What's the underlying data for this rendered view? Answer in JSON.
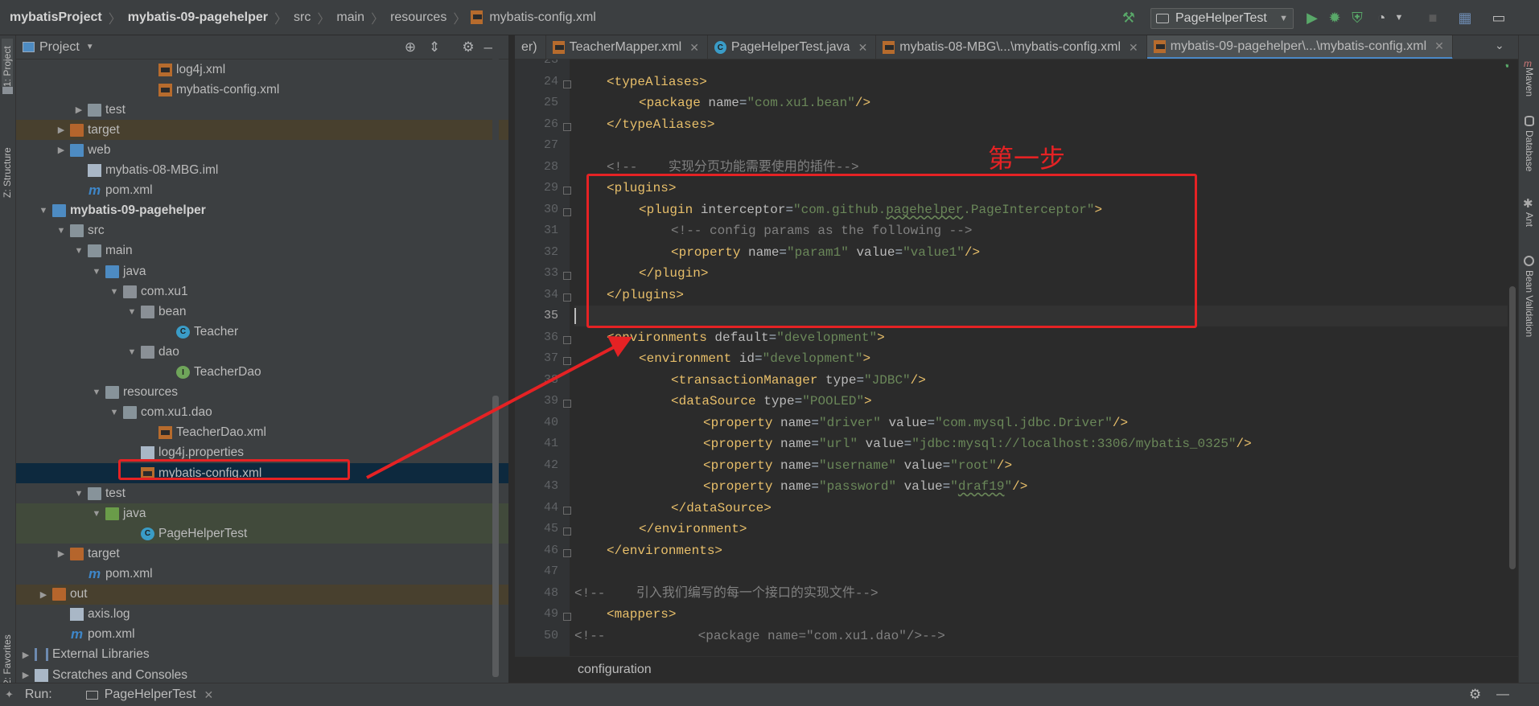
{
  "breadcrumb": [
    "mybatisProject",
    "mybatis-09-pagehelper",
    "src",
    "main",
    "resources",
    "mybatis-config.xml"
  ],
  "toolbar": {
    "run_config": "PageHelperTest",
    "icons": [
      "hammer-icon",
      "run-config-dropdown",
      "run-icon",
      "debug-icon",
      "coverage-icon",
      "profiler-icon",
      "stop-icon",
      "project-structure-icon",
      "toggle-layout-icon"
    ]
  },
  "left_strip": {
    "project": "1: Project",
    "structure": "Z: Structure",
    "favorites": "2: Favorites"
  },
  "right_strip": {
    "maven": "Maven",
    "database": "Database",
    "ant": "Ant",
    "bean_validation": "Bean Validation"
  },
  "project_panel": {
    "title": "Project",
    "rows": [
      {
        "label": "log4j.xml",
        "indent": 7,
        "icon": "xml",
        "arrow": ""
      },
      {
        "label": "mybatis-config.xml",
        "indent": 7,
        "icon": "xml",
        "arrow": ""
      },
      {
        "label": "test",
        "indent": 3,
        "icon": "folder",
        "arrow": "right"
      },
      {
        "label": "target",
        "indent": 2,
        "icon": "folder-target",
        "arrow": "right",
        "style": "tgt"
      },
      {
        "label": "web",
        "indent": 2,
        "icon": "folder-web",
        "arrow": "right"
      },
      {
        "label": "mybatis-08-MBG.iml",
        "indent": 3,
        "icon": "iml",
        "arrow": ""
      },
      {
        "label": "pom.xml",
        "indent": 3,
        "icon": "maven",
        "arrow": ""
      },
      {
        "label": "mybatis-09-pagehelper",
        "indent": 1,
        "icon": "module",
        "arrow": "down",
        "style": "bold"
      },
      {
        "label": "src",
        "indent": 2,
        "icon": "folder",
        "arrow": "down"
      },
      {
        "label": "main",
        "indent": 3,
        "icon": "folder",
        "arrow": "down"
      },
      {
        "label": "java",
        "indent": 4,
        "icon": "folder-blue",
        "arrow": "down"
      },
      {
        "label": "com.xu1",
        "indent": 5,
        "icon": "package",
        "arrow": "down"
      },
      {
        "label": "bean",
        "indent": 6,
        "icon": "package",
        "arrow": "down"
      },
      {
        "label": "Teacher",
        "indent": 8,
        "icon": "class",
        "arrow": ""
      },
      {
        "label": "dao",
        "indent": 6,
        "icon": "package",
        "arrow": "down"
      },
      {
        "label": "TeacherDao",
        "indent": 8,
        "icon": "interface",
        "arrow": ""
      },
      {
        "label": "resources",
        "indent": 4,
        "icon": "folder-res",
        "arrow": "down"
      },
      {
        "label": "com.xu1.dao",
        "indent": 5,
        "icon": "folder",
        "arrow": "down"
      },
      {
        "label": "TeacherDao.xml",
        "indent": 7,
        "icon": "xml",
        "arrow": ""
      },
      {
        "label": "log4j.properties",
        "indent": 6,
        "icon": "props",
        "arrow": ""
      },
      {
        "label": "mybatis-config.xml",
        "indent": 6,
        "icon": "xml",
        "arrow": "",
        "style": "sel"
      },
      {
        "label": "test",
        "indent": 3,
        "icon": "folder",
        "arrow": "down"
      },
      {
        "label": "java",
        "indent": 4,
        "icon": "folder-green",
        "arrow": "down",
        "style": "tst"
      },
      {
        "label": "PageHelperTest",
        "indent": 6,
        "icon": "class",
        "arrow": "",
        "style": "tst"
      },
      {
        "label": "target",
        "indent": 2,
        "icon": "folder-target",
        "arrow": "right"
      },
      {
        "label": "pom.xml",
        "indent": 3,
        "icon": "maven",
        "arrow": ""
      },
      {
        "label": "out",
        "indent": 1,
        "icon": "folder-target",
        "arrow": "right",
        "style": "tgt"
      },
      {
        "label": "axis.log",
        "indent": 2,
        "icon": "file",
        "arrow": ""
      },
      {
        "label": "pom.xml",
        "indent": 2,
        "icon": "maven",
        "arrow": ""
      },
      {
        "label": "External Libraries",
        "indent": 0,
        "icon": "library",
        "arrow": "right"
      },
      {
        "label": "Scratches and Consoles",
        "indent": 0,
        "icon": "scratch",
        "arrow": "right"
      }
    ]
  },
  "tabs": [
    {
      "label": "er)",
      "icon": "",
      "closable": false,
      "active": false
    },
    {
      "label": "TeacherMapper.xml",
      "icon": "xml",
      "closable": true,
      "active": false
    },
    {
      "label": "PageHelperTest.java",
      "icon": "class",
      "closable": true,
      "active": false
    },
    {
      "label": "mybatis-08-MBG\\...\\mybatis-config.xml",
      "icon": "xml",
      "closable": true,
      "active": false
    },
    {
      "label": "mybatis-09-pagehelper\\...\\mybatis-config.xml",
      "icon": "xml",
      "closable": true,
      "active": true
    }
  ],
  "editor": {
    "current_line": 35,
    "lines": [
      {
        "n": 23,
        "indent": 0,
        "seg": []
      },
      {
        "n": 24,
        "indent": 1,
        "fold": true,
        "seg": [
          [
            "tg",
            "<typeAliases>"
          ]
        ]
      },
      {
        "n": 25,
        "indent": 2,
        "seg": [
          [
            "tg",
            "<package "
          ],
          [
            "at",
            "name"
          ],
          [
            "tx",
            "="
          ],
          [
            "vl",
            "\"com.xu1.bean\""
          ],
          [
            "tg",
            "/>"
          ]
        ]
      },
      {
        "n": 26,
        "indent": 1,
        "fold": true,
        "seg": [
          [
            "tg",
            "</typeAliases>"
          ]
        ]
      },
      {
        "n": 27,
        "indent": 0,
        "seg": []
      },
      {
        "n": 28,
        "indent": 1,
        "seg": [
          [
            "cm",
            "<!--    实现分页功能需要使用的插件-->"
          ]
        ]
      },
      {
        "n": 29,
        "indent": 1,
        "fold": true,
        "seg": [
          [
            "tg",
            "<plugins>"
          ]
        ]
      },
      {
        "n": 30,
        "indent": 2,
        "fold": true,
        "seg": [
          [
            "tg",
            "<plugin "
          ],
          [
            "at",
            "interceptor"
          ],
          [
            "tx",
            "="
          ],
          [
            "vl",
            "\"com.github."
          ],
          [
            "vlu",
            "pagehelper"
          ],
          [
            "vl",
            ".PageInterceptor\""
          ],
          [
            "tg",
            ">"
          ]
        ]
      },
      {
        "n": 31,
        "indent": 3,
        "seg": [
          [
            "cm",
            "<!-- config params as the following -->"
          ]
        ]
      },
      {
        "n": 32,
        "indent": 3,
        "seg": [
          [
            "tg",
            "<property "
          ],
          [
            "at",
            "name"
          ],
          [
            "tx",
            "="
          ],
          [
            "vl",
            "\"param1\""
          ],
          [
            "at",
            " value"
          ],
          [
            "tx",
            "="
          ],
          [
            "vl",
            "\"value1\""
          ],
          [
            "tg",
            "/>"
          ]
        ]
      },
      {
        "n": 33,
        "indent": 2,
        "fold": true,
        "seg": [
          [
            "tg",
            "</plugin>"
          ]
        ]
      },
      {
        "n": 34,
        "indent": 1,
        "fold": true,
        "seg": [
          [
            "tg",
            "</plugins>"
          ]
        ]
      },
      {
        "n": 35,
        "indent": 0,
        "seg": []
      },
      {
        "n": 36,
        "indent": 1,
        "fold": true,
        "seg": [
          [
            "tg",
            "<environments "
          ],
          [
            "at",
            "default"
          ],
          [
            "tx",
            "="
          ],
          [
            "vl",
            "\"development\""
          ],
          [
            "tg",
            ">"
          ]
        ]
      },
      {
        "n": 37,
        "indent": 2,
        "fold": true,
        "seg": [
          [
            "tg",
            "<environment "
          ],
          [
            "at",
            "id"
          ],
          [
            "tx",
            "="
          ],
          [
            "vl",
            "\"development\""
          ],
          [
            "tg",
            ">"
          ]
        ]
      },
      {
        "n": 38,
        "indent": 3,
        "seg": [
          [
            "tg",
            "<transactionManager "
          ],
          [
            "at",
            "type"
          ],
          [
            "tx",
            "="
          ],
          [
            "vl",
            "\"JDBC\""
          ],
          [
            "tg",
            "/>"
          ]
        ]
      },
      {
        "n": 39,
        "indent": 3,
        "fold": true,
        "seg": [
          [
            "tg",
            "<dataSource "
          ],
          [
            "at",
            "type"
          ],
          [
            "tx",
            "="
          ],
          [
            "vl",
            "\"POOLED\""
          ],
          [
            "tg",
            ">"
          ]
        ]
      },
      {
        "n": 40,
        "indent": 4,
        "seg": [
          [
            "tg",
            "<property "
          ],
          [
            "at",
            "name"
          ],
          [
            "tx",
            "="
          ],
          [
            "vl",
            "\"driver\""
          ],
          [
            "at",
            " value"
          ],
          [
            "tx",
            "="
          ],
          [
            "vl",
            "\"com.mysql.jdbc.Driver\""
          ],
          [
            "tg",
            "/>"
          ]
        ]
      },
      {
        "n": 41,
        "indent": 4,
        "seg": [
          [
            "tg",
            "<property "
          ],
          [
            "at",
            "name"
          ],
          [
            "tx",
            "="
          ],
          [
            "vl",
            "\"url\""
          ],
          [
            "at",
            " value"
          ],
          [
            "tx",
            "="
          ],
          [
            "vl",
            "\"jdbc:mysql://localhost:3306/mybatis_0325\""
          ],
          [
            "tg",
            "/>"
          ]
        ]
      },
      {
        "n": 42,
        "indent": 4,
        "seg": [
          [
            "tg",
            "<property "
          ],
          [
            "at",
            "name"
          ],
          [
            "tx",
            "="
          ],
          [
            "vl",
            "\"username\""
          ],
          [
            "at",
            " value"
          ],
          [
            "tx",
            "="
          ],
          [
            "vl",
            "\"root\""
          ],
          [
            "tg",
            "/>"
          ]
        ]
      },
      {
        "n": 43,
        "indent": 4,
        "seg": [
          [
            "tg",
            "<property "
          ],
          [
            "at",
            "name"
          ],
          [
            "tx",
            "="
          ],
          [
            "vl",
            "\"password\""
          ],
          [
            "at",
            " value"
          ],
          [
            "tx",
            "="
          ],
          [
            "vl",
            "\""
          ],
          [
            "vlu",
            "draf19"
          ],
          [
            "vl",
            "\""
          ],
          [
            "tg",
            "/>"
          ]
        ]
      },
      {
        "n": 44,
        "indent": 3,
        "fold": true,
        "seg": [
          [
            "tg",
            "</dataSource>"
          ]
        ]
      },
      {
        "n": 45,
        "indent": 2,
        "fold": true,
        "seg": [
          [
            "tg",
            "</environment>"
          ]
        ]
      },
      {
        "n": 46,
        "indent": 1,
        "fold": true,
        "seg": [
          [
            "tg",
            "</environments>"
          ]
        ]
      },
      {
        "n": 47,
        "indent": 0,
        "seg": []
      },
      {
        "n": 48,
        "indent": 0,
        "seg": [
          [
            "cm",
            "<!--    引入我们编写的每一个接口的实现文件-->"
          ]
        ]
      },
      {
        "n": 49,
        "indent": 1,
        "fold": true,
        "seg": [
          [
            "tg",
            "<mappers>"
          ]
        ]
      },
      {
        "n": 50,
        "indent": 0,
        "seg": [
          [
            "cm",
            "<!--            <package name=\"com.xu1.dao\"/>-->"
          ]
        ]
      }
    ]
  },
  "editor_breadcrumb": "configuration",
  "annotation": {
    "label": "第一步",
    "color": "#e52224"
  },
  "run_bar": {
    "label": "Run:",
    "config": "PageHelperTest"
  },
  "colors": {
    "accent": "#4a88c7",
    "annotation_red": "#e52224",
    "tag": "#e8bf6a",
    "value": "#6a8759",
    "comment": "#808080"
  }
}
